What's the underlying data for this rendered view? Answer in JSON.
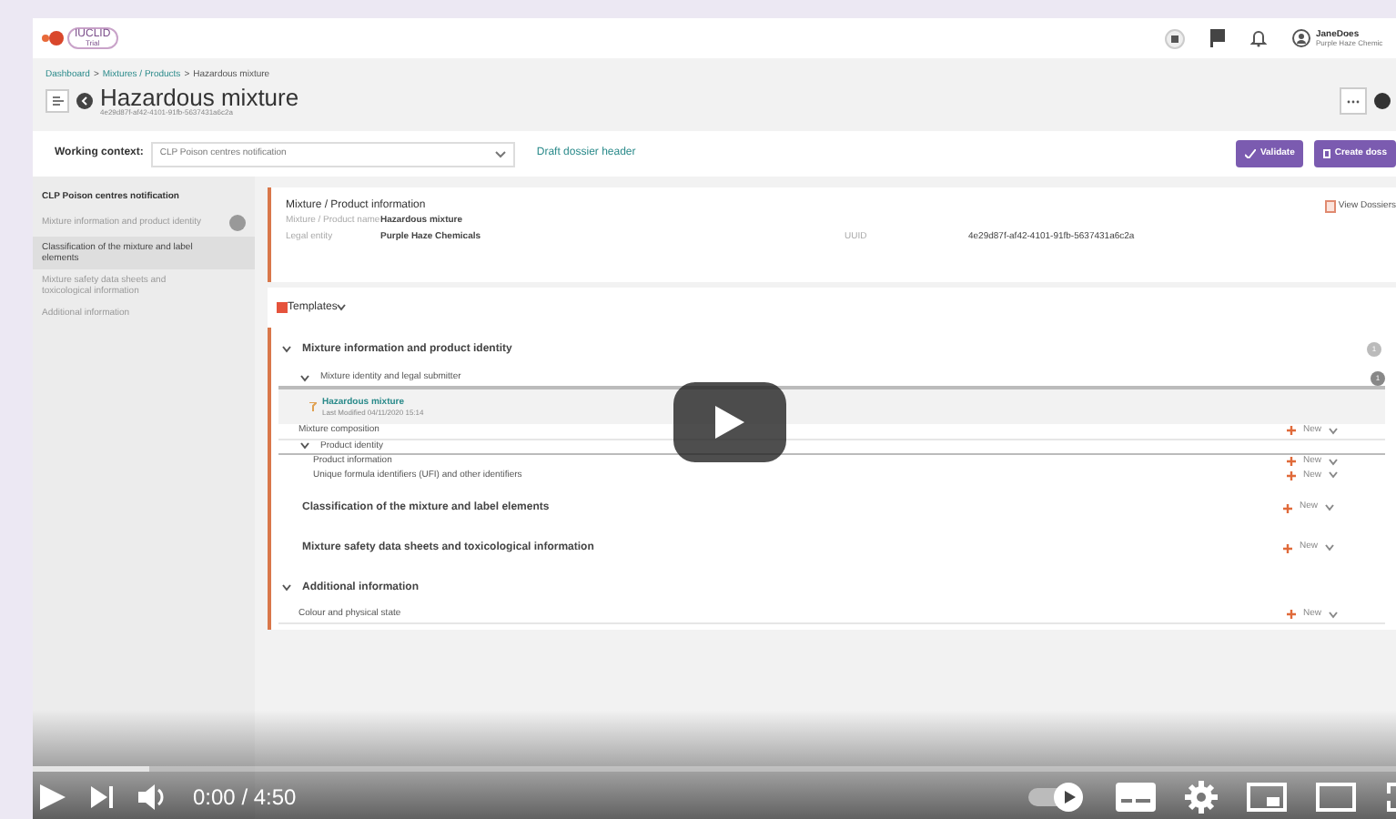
{
  "app": {
    "logo": "IUCLID",
    "logo_sub": "Trial",
    "user": {
      "name": "JaneDoes",
      "org": "Purple Haze Chemic"
    }
  },
  "breadcrumb": {
    "separator": ">",
    "items": [
      "Dashboard",
      "Mixtures / Products",
      "Hazardous mixture"
    ]
  },
  "page": {
    "title": "Hazardous mixture",
    "uuid": "4e29d87f-af42-4101-91fb-5637431a6c2a"
  },
  "context": {
    "label": "Working context:",
    "value": "CLP Poison centres notification",
    "link": "Draft dossier header",
    "buttons": [
      "Validate",
      "Create doss"
    ]
  },
  "sidebar": {
    "heading": "CLP Poison centres notification",
    "items": [
      {
        "label": "Mixture information and product identity",
        "selected": false,
        "badge": true
      },
      {
        "label": "Classification of the mixture and label elements",
        "selected": true,
        "badge": false
      },
      {
        "label": "Mixture safety data sheets and toxicological information",
        "selected": false,
        "badge": false
      },
      {
        "label": "Additional information",
        "selected": false,
        "badge": false
      }
    ]
  },
  "info": {
    "title": "Mixture / Product information",
    "action": "View Dossiers",
    "fields": [
      {
        "label": "Mixture / Product name",
        "value": "Hazardous mixture"
      },
      {
        "label": "Legal entity",
        "value": "Purple Haze Chemicals"
      }
    ],
    "uuid_label": "UUID",
    "uuid": "4e29d87f-af42-4101-91fb-5637431a6c2a"
  },
  "templates": "Templates",
  "sections": [
    {
      "title": "Mixture information and product identity",
      "expanded": true,
      "badge": "1",
      "children": [
        {
          "kind": "group",
          "label": "Mixture identity and legal submitter",
          "badge": "1",
          "children": [
            {
              "kind": "record",
              "label": "Hazardous mixture",
              "meta": "Last Modified 04/11/2020 15:14"
            }
          ]
        },
        {
          "kind": "leaf",
          "label": "Mixture composition",
          "action": "New"
        },
        {
          "kind": "group",
          "label": "Product identity",
          "children": [
            {
              "kind": "leaf",
              "label": "Product information",
              "action": "New"
            },
            {
              "kind": "leaf",
              "label": "Unique formula identifiers (UFI) and other identifiers",
              "action": "New"
            }
          ]
        }
      ]
    },
    {
      "title": "Classification of the mixture and label elements",
      "expanded": false,
      "action": "New"
    },
    {
      "title": "Mixture safety data sheets and toxicological information",
      "expanded": false,
      "action": "New"
    },
    {
      "title": "Additional information",
      "expanded": true,
      "children": [
        {
          "kind": "leaf",
          "label": "Colour and physical state",
          "action": "New"
        }
      ]
    }
  ],
  "player": {
    "time": "0:00 / 4:50",
    "progress": {
      "level": 0.085
    }
  }
}
